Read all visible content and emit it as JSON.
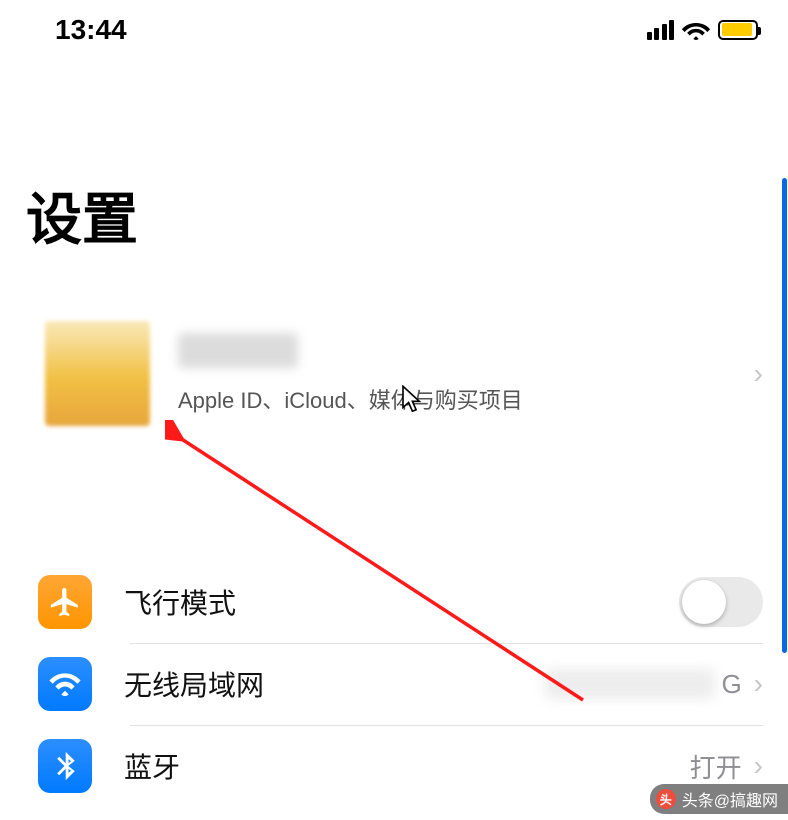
{
  "status": {
    "time": "13:44"
  },
  "title": "设置",
  "account": {
    "subtitle": "Apple ID、iCloud、媒体与购买项目"
  },
  "rows": {
    "airplane": {
      "label": "飞行模式",
      "toggle": false
    },
    "wifi": {
      "label": "无线局域网",
      "value_suffix": "G"
    },
    "bluetooth": {
      "label": "蓝牙",
      "value": "打开"
    }
  },
  "watermark": {
    "badge": "头",
    "text": "头条@搞趣网"
  }
}
